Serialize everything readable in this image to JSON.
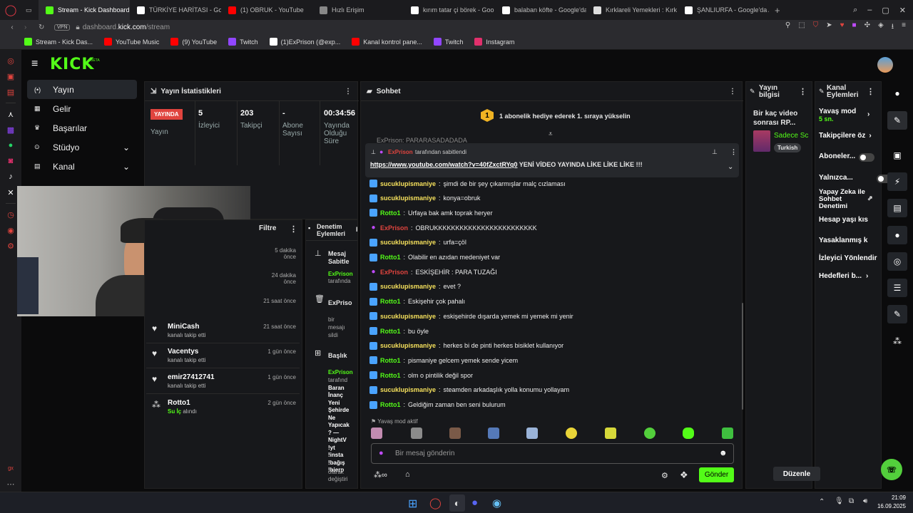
{
  "browser": {
    "tabs": [
      {
        "label": "Stream - Kick Dashboard",
        "color": "#53fc18",
        "active": true
      },
      {
        "label": "TÜRKİYE HARİTASI - Goo",
        "color": "#ffffff"
      },
      {
        "label": "(1) OBRUK - YouTube",
        "color": "#ff0000"
      },
      {
        "label": "Hızlı Erişim",
        "color": "#888888"
      },
      {
        "label": "kırım tatar çi börek - Goo",
        "color": "#ffffff"
      },
      {
        "label": "balaban köfte - Google'da",
        "color": "#ffffff"
      },
      {
        "label": "Kırklareli Yemekleri : Kırk",
        "color": "#dddddd"
      },
      {
        "label": "ŞANLIURFA - Google'da A",
        "color": "#ffffff"
      }
    ],
    "vpn": "VPN",
    "url_prefix": "dashboard.",
    "url_domain": "kick.com",
    "url_path": "/stream",
    "bookmarks": [
      {
        "label": "Stream - Kick Das...",
        "color": "#53fc18"
      },
      {
        "label": "YouTube Music",
        "color": "#ff0000"
      },
      {
        "label": "(9) YouTube",
        "color": "#ff0000"
      },
      {
        "label": "Twitch",
        "color": "#9146ff"
      },
      {
        "label": "(1)ExPrison (@exp...",
        "color": "#ffffff"
      },
      {
        "label": "Kanal kontrol pane...",
        "color": "#ff0000"
      },
      {
        "label": "Twitch",
        "color": "#9146ff"
      },
      {
        "label": "Instagram",
        "color": "#e1306c"
      }
    ]
  },
  "kick": {
    "logo": "KICK",
    "logo_beta": "BETA",
    "nav": [
      {
        "label": "Yayın",
        "icon": "broadcast-icon"
      },
      {
        "label": "Gelir",
        "icon": "revenue-icon"
      },
      {
        "label": "Başarılar",
        "icon": "trophy-icon"
      },
      {
        "label": "Stüdyo",
        "icon": "studio-icon"
      },
      {
        "label": "Kanal",
        "icon": "channel-icon"
      }
    ],
    "stats": {
      "title": "Yayın İstatistikleri",
      "live_badge": "YAYINDA",
      "live_label": "Yayın",
      "viewers_val": "5",
      "viewers_label": "İzleyici",
      "followers_val": "203",
      "followers_label": "Takipçi",
      "subs_val": "-",
      "subs_label": "Abone Sayısı",
      "uptime_val": "00:34:56",
      "uptime_label": "Yayında Olduğu Süre"
    },
    "filter_label": "Filtre",
    "feed": [
      {
        "time": "5 dakika önce"
      },
      {
        "time": "24 dakika önce"
      },
      {
        "time": "21 saat önce"
      },
      {
        "name": "MiniCash",
        "sub": "kanalı takip etti",
        "time": "21 saat önce"
      },
      {
        "name": "Vacentys",
        "sub": "kanalı takip etti",
        "time": "1 gün önce"
      },
      {
        "name": "emir27412741",
        "sub": "kanalı takip etti",
        "time": "1 gün önce"
      },
      {
        "name": "Rotto1",
        "sub_green": "Su İç",
        "sub": " alındı",
        "time": "2 gün önce"
      }
    ],
    "mod": {
      "title": "Denetim Eylemleri",
      "item1_title": "Mesaj Sabitle",
      "item1_user": "ExPrison",
      "item1_sub": "tarafında",
      "item2_title": "ExPriso",
      "item2_sub1": "bir",
      "item2_sub2": "mesajı",
      "item2_sub3": "sildi",
      "item3_title": "Başlık",
      "item3_user": "ExPrison",
      "item3_lines": [
        "tarafınd",
        "Baran",
        "İnanç",
        "Yeni",
        "Şehirde",
        "Ne",
        "Yapıcak",
        "? —",
        "NightV",
        "!yt",
        "!insta",
        "!bağış",
        "!bierp"
      ],
      "item3_tail1": "olarak",
      "item3_tail2": "değiştiri"
    },
    "chat": {
      "title": "Sohbet",
      "gift_num": "1",
      "gift_text": "1 abonelik hediye ederek 1. sıraya yükselin",
      "hidden_line": "ExPrison: PARARASADADADA",
      "pinned_by_user": "ExPrison",
      "pinned_by_text": "tarafından sabitlendi",
      "pinned_link": "https://www.youtube.com/watch?v=40fZxctRYq0",
      "pinned_text": " YENİ VİDEO YAYINDA LİKE LİKE LİKE !!!",
      "messages": [
        {
          "user": "sucuklupismaniye",
          "text": "şimdi de bir şey çıkarmışlar malç cızlaması",
          "role": "y"
        },
        {
          "user": "sucuklupismaniye",
          "text": "konya=obruk",
          "role": "y"
        },
        {
          "user": "Rotto1",
          "text": "Urfaya bak amk toprak heryer",
          "role": "g"
        },
        {
          "user": "ExPrison",
          "text": "OBRUKKKKKKKKKKKKKKKKKKKKKKKK",
          "role": "r"
        },
        {
          "user": "sucuklupismaniye",
          "text": "urfa=çöl",
          "role": "y"
        },
        {
          "user": "Rotto1",
          "text": "Olabilir en azıdan medeniyet var",
          "role": "g"
        },
        {
          "user": "ExPrison",
          "text": "ESKİŞEHİR : PARA TUZAĞI",
          "role": "r"
        },
        {
          "user": "sucuklupismaniye",
          "text": "evet ?",
          "role": "y"
        },
        {
          "user": "Rotto1",
          "text": "Eskişehir çok pahalı",
          "role": "g"
        },
        {
          "user": "sucuklupismaniye",
          "text": "eskişehirde dışarda yemek mi yemek mi yenir",
          "role": "y"
        },
        {
          "user": "Rotto1",
          "text": "bu öyle",
          "role": "g"
        },
        {
          "user": "sucuklupismaniye",
          "text": "herkes bi de pinti herkes bisiklet kullanıyor",
          "role": "y"
        },
        {
          "user": "Rotto1",
          "text": "pismaniye gelcem yemek sende yicem",
          "role": "g"
        },
        {
          "user": "Rotto1",
          "text": "olm o pintilik değil spor",
          "role": "g"
        },
        {
          "user": "sucuklupismaniye",
          "text": "steamden arkadaşlık yolla konumu yollayam",
          "role": "y"
        },
        {
          "user": "Rotto1",
          "text": "Geldiğim zaman ben seni bulurum",
          "role": "g"
        }
      ],
      "slow_mode": "Yavaş mod aktif",
      "input_placeholder": "Bir mesaj gönderin",
      "send_label": "Gönder"
    },
    "stream_info": {
      "title": "Yayın bilgisi",
      "stream_title": "Bir kaç video sonrası RP...",
      "category": "Sadece Sc",
      "tag": "Turkish"
    },
    "channel_actions": {
      "title": "Kanal Eylemleri",
      "slow_mode": "Yavaş mod",
      "slow_val": "5 sn.",
      "followers": "Takipçilere öz",
      "subs": "Aboneler...",
      "only": "Yalnızca...",
      "ai": "Yapay Zeka ile Sohbet Denetimi",
      "age": "Hesap yaşı kıs",
      "banned": "Yasaklanmış k",
      "redirect": "İzleyici Yönlendir",
      "goals": "Hedefleri b...",
      "edit": "Düzenle"
    }
  },
  "taskbar": {
    "time": "21:09",
    "date": "16.09.2025"
  }
}
